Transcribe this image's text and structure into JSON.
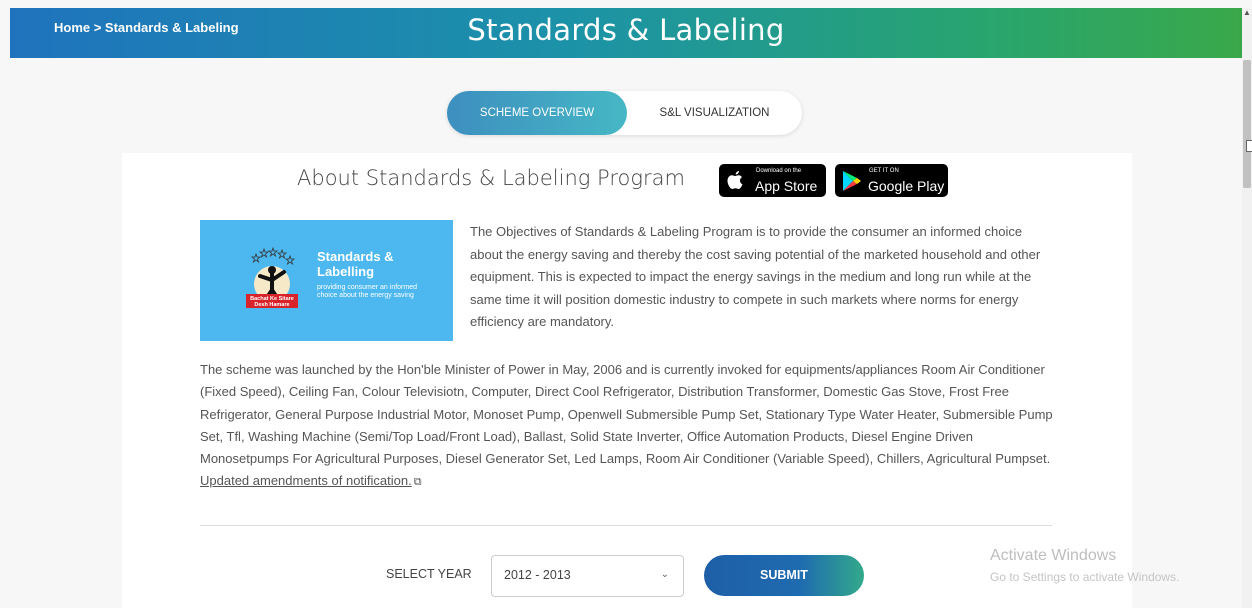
{
  "header": {
    "breadcrumb": "Home > Standards & Labeling",
    "title": "Standards & Labeling"
  },
  "tabs": [
    {
      "label": "SCHEME OVERVIEW",
      "active": true
    },
    {
      "label": "S&L VISUALIZATION",
      "active": false
    }
  ],
  "about": {
    "title": "About Standards & Labeling Program",
    "app_store": {
      "small": "Download on the",
      "big": "App Store"
    },
    "google_play": {
      "small": "GET IT ON",
      "big": "Google Play"
    }
  },
  "banner": {
    "title_line1": "Standards &",
    "title_line2": "Labelling",
    "subtitle": "providing consumer an informed choice about the energy saving",
    "logo_text": "Bachat Ke Sitare Desh Hamare"
  },
  "objectives_text": "The Objectives of Standards & Labeling Program is to provide the consumer an informed choice about the energy saving and thereby the cost saving potential of the marketed household and other equipment. This is expected to impact the energy savings in the medium and long run while at the same time it will position domestic industry to compete in such markets where norms for energy efficiency are mandatory.",
  "scheme": {
    "text": "The scheme was launched by the Hon'ble Minister of Power in May, 2006 and is currently invoked for equipments/appliances Room Air Conditioner (Fixed Speed), Ceiling Fan, Colour Televisiotn, Computer, Direct Cool Refrigerator, Distribution Transformer, Domestic Gas Stove, Frost Free Refrigerator, General Purpose Industrial Motor, Monoset Pump, Openwell Submersible Pump Set, Stationary Type Water Heater, Submersible Pump Set, Tfl, Washing Machine (Semi/Top Load/Front Load), Ballast, Solid State Inverter, Office Automation Products, Diesel Engine Driven Monosetpumps For Agricultural Purposes, Diesel Generator Set, Led Lamps, Room Air Conditioner (Variable Speed), Chillers, Agricultural Pumpset. ",
    "link_text": "Updated amendments of notification."
  },
  "year_form": {
    "label": "SELECT YEAR",
    "selected": "2012 - 2013",
    "submit_label": "SUBMIT"
  },
  "watermark": {
    "title": "Activate Windows",
    "subtitle": "Go to Settings to activate Windows."
  },
  "colors": {
    "header_start": "#1f73bd",
    "header_end": "#3aa84a",
    "banner_bg": "#4db8f0",
    "submit_start": "#1e5fa8",
    "submit_end": "#33a98a"
  }
}
